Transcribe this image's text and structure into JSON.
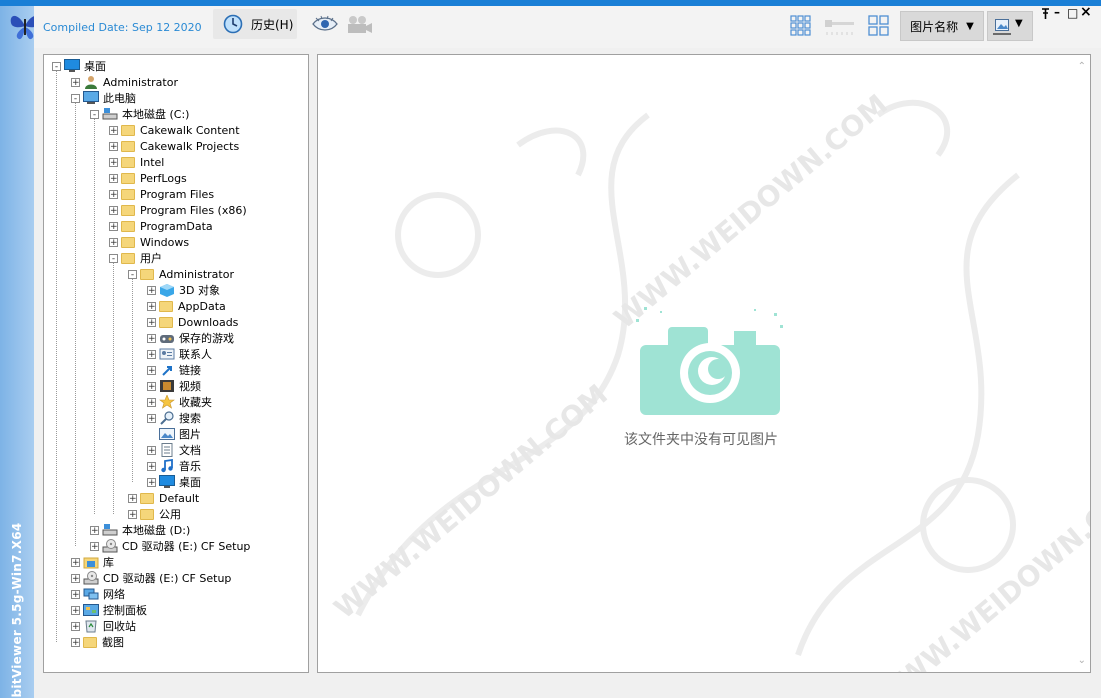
{
  "app": {
    "compiled": "Compiled Date: Sep 12 2020",
    "vertical_title": "bitViewer 5.5g-Win7.X64"
  },
  "toolbar": {
    "history_label": "历史(H)",
    "sort_label": "图片名称",
    "sort_arrow": "▼",
    "view_arrow": "▼",
    "pin": "⸮",
    "minimize": "–",
    "maximize": "□",
    "close": "×"
  },
  "tree": {
    "nodes": [
      {
        "label": "桌面",
        "icon": "desktop-icon",
        "expander": "-"
      },
      {
        "label": "Administrator",
        "icon": "user-icon",
        "expander": "+"
      },
      {
        "label": "此电脑",
        "icon": "computer-icon",
        "expander": "-"
      },
      {
        "label": "本地磁盘 (C:)",
        "icon": "drive-icon",
        "expander": "-"
      },
      {
        "label": "Cakewalk Content",
        "icon": "folder-icon",
        "expander": "+"
      },
      {
        "label": "Cakewalk Projects",
        "icon": "folder-icon",
        "expander": "+"
      },
      {
        "label": "Intel",
        "icon": "folder-icon",
        "expander": "+"
      },
      {
        "label": "PerfLogs",
        "icon": "folder-icon",
        "expander": "+"
      },
      {
        "label": "Program Files",
        "icon": "folder-icon",
        "expander": "+"
      },
      {
        "label": "Program Files (x86)",
        "icon": "folder-icon",
        "expander": "+"
      },
      {
        "label": "ProgramData",
        "icon": "folder-icon",
        "expander": "+"
      },
      {
        "label": "Windows",
        "icon": "folder-icon",
        "expander": "+"
      },
      {
        "label": "用户",
        "icon": "folder-icon",
        "expander": "-"
      },
      {
        "label": "Administrator",
        "icon": "folder-icon",
        "expander": "-"
      },
      {
        "label": "3D 对象",
        "icon": "cube-icon",
        "expander": "+"
      },
      {
        "label": "AppData",
        "icon": "folder-icon",
        "expander": "+"
      },
      {
        "label": "Downloads",
        "icon": "folder-icon",
        "expander": "+"
      },
      {
        "label": "保存的游戏",
        "icon": "game-icon",
        "expander": "+"
      },
      {
        "label": "联系人",
        "icon": "contacts-icon",
        "expander": "+"
      },
      {
        "label": "链接",
        "icon": "link-icon",
        "expander": "+"
      },
      {
        "label": "视频",
        "icon": "video-icon",
        "expander": "+"
      },
      {
        "label": "收藏夹",
        "icon": "star-icon",
        "expander": "+"
      },
      {
        "label": "搜索",
        "icon": "search-icon",
        "expander": "+"
      },
      {
        "label": "图片",
        "icon": "pictures-icon",
        "expander": ""
      },
      {
        "label": "文档",
        "icon": "document-icon",
        "expander": "+"
      },
      {
        "label": "音乐",
        "icon": "music-icon",
        "expander": "+"
      },
      {
        "label": "桌面",
        "icon": "desktop-icon",
        "expander": "+"
      },
      {
        "label": "Default",
        "icon": "folder-icon",
        "expander": "+"
      },
      {
        "label": "公用",
        "icon": "folder-icon",
        "expander": "+"
      },
      {
        "label": "本地磁盘 (D:)",
        "icon": "drive-icon",
        "expander": "+"
      },
      {
        "label": "CD 驱动器 (E:) CF Setup",
        "icon": "cd-icon",
        "expander": "+"
      },
      {
        "label": "库",
        "icon": "library-icon",
        "expander": "+"
      },
      {
        "label": "CD 驱动器 (E:) CF Setup",
        "icon": "cd-icon",
        "expander": "+"
      },
      {
        "label": "网络",
        "icon": "network-icon",
        "expander": "+"
      },
      {
        "label": "控制面板",
        "icon": "control-panel-icon",
        "expander": "+"
      },
      {
        "label": "回收站",
        "icon": "recycle-bin-icon",
        "expander": "+"
      },
      {
        "label": "截图",
        "icon": "folder-icon",
        "expander": "+"
      }
    ]
  },
  "content": {
    "empty_message": "该文件夹中没有可见图片",
    "watermark": "WWW.WEIDOWN.COM"
  },
  "colors": {
    "accent": "#1a7fd6",
    "compiled_text": "#2a8ad4",
    "camera": "#9fe3d4"
  }
}
